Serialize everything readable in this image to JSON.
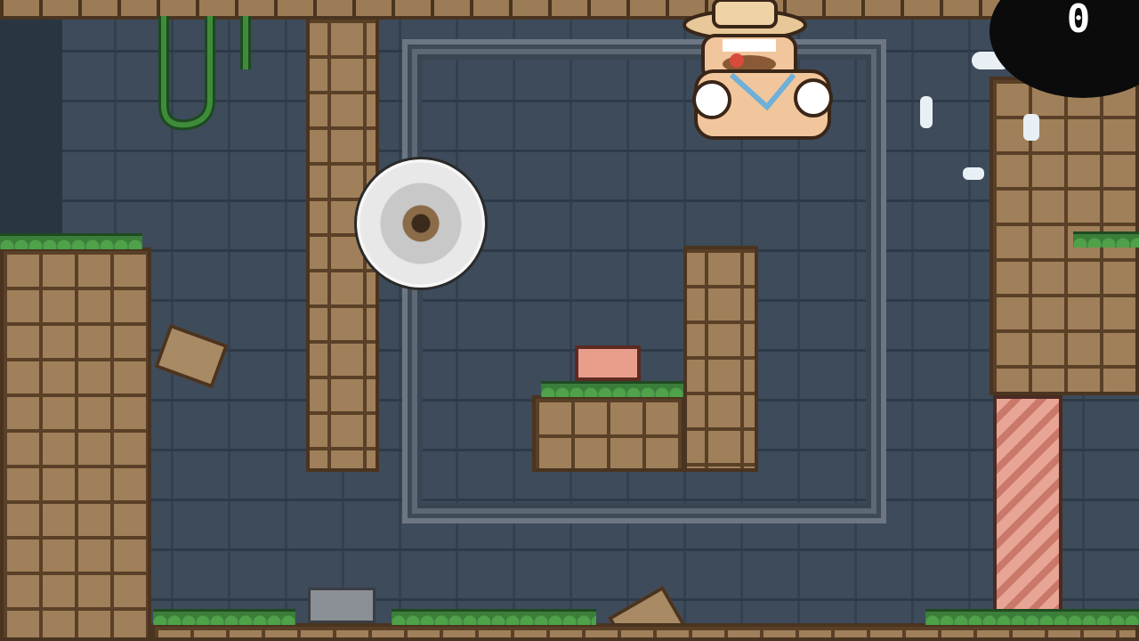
{
  "hud": {
    "counter_value": "0"
  },
  "scene": {
    "theme": "temple ruins",
    "colors": {
      "wall": "#3d4b5b",
      "brick": "#a0805a",
      "grass": "#4fa14a",
      "hazard": "#e8e8e8",
      "switch_block": "#e99e8c"
    }
  },
  "icons": {
    "player": "explorer-icon",
    "hazard": "saw-blade-icon"
  }
}
